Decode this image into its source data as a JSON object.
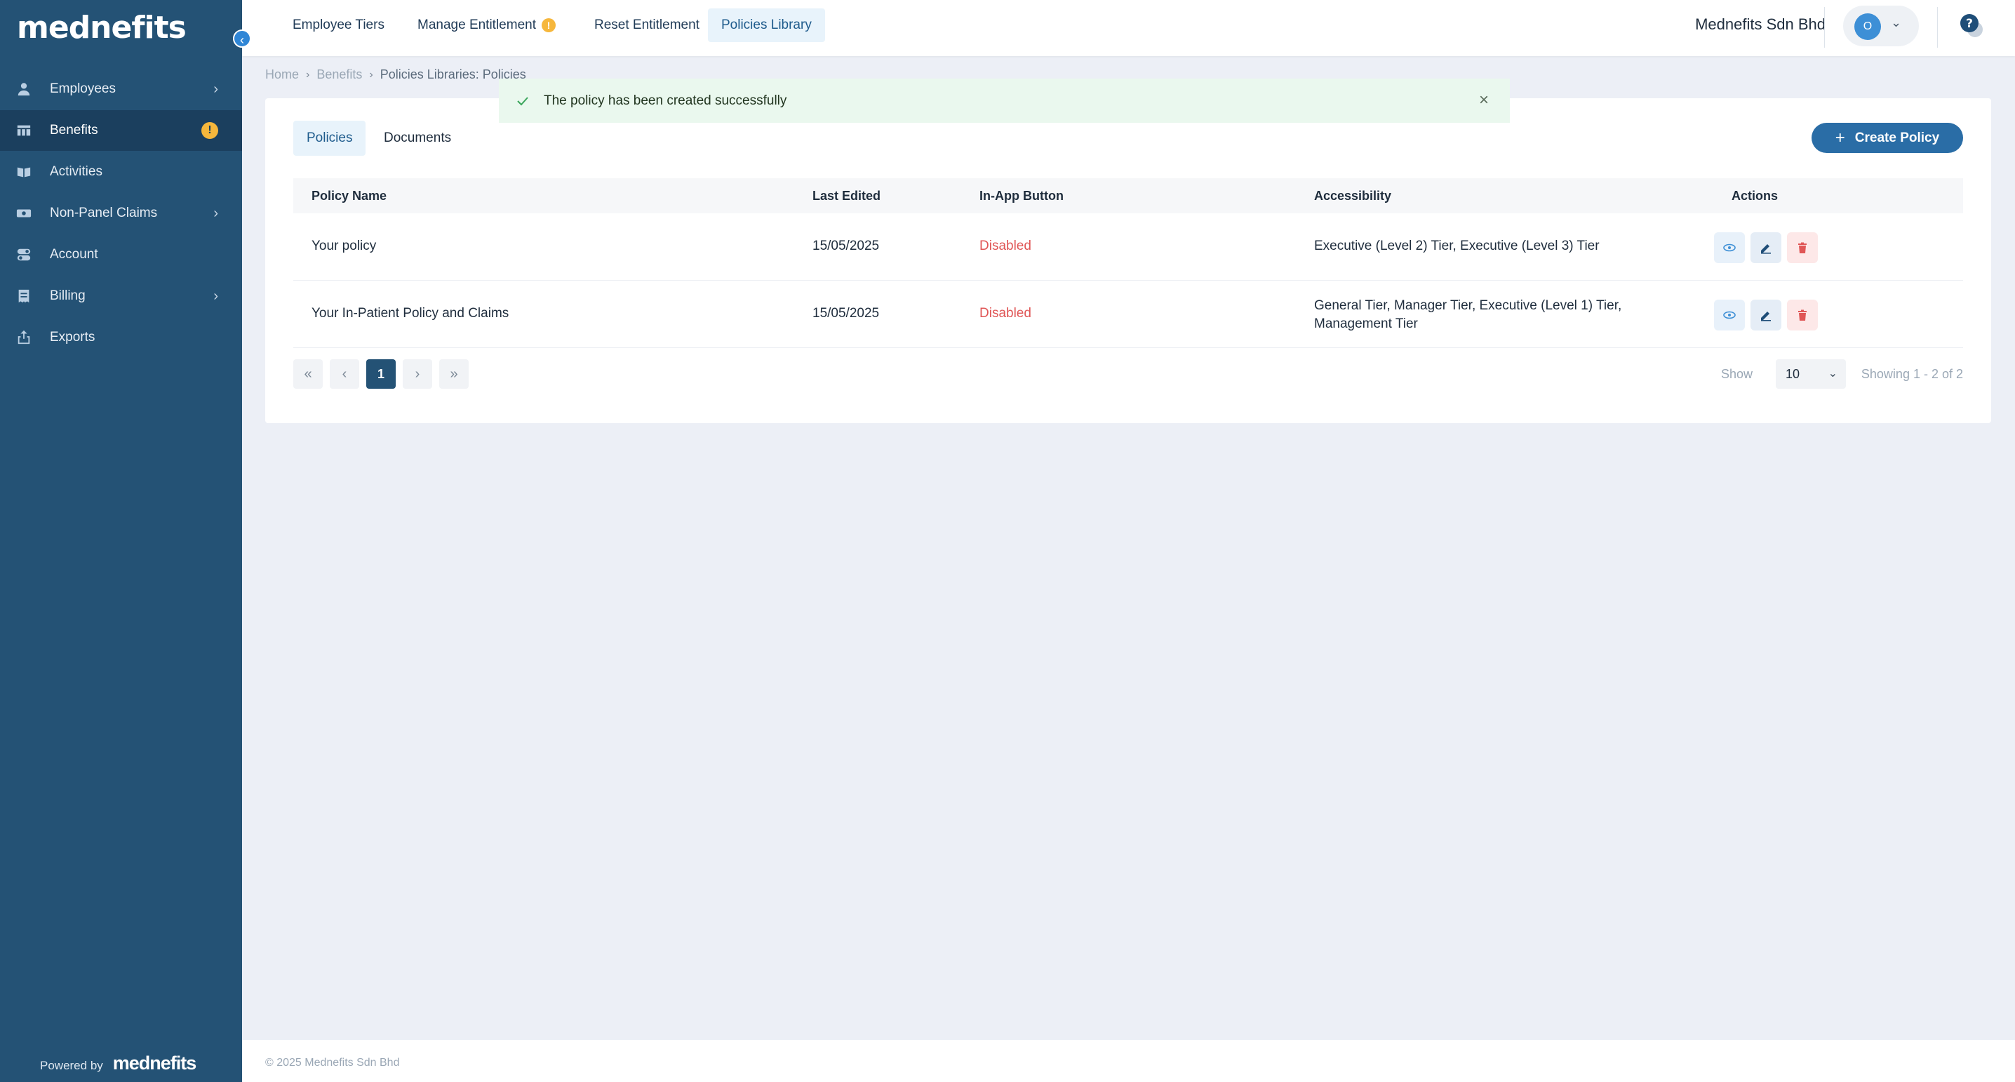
{
  "brand": {
    "logo_text": "mednefits",
    "powered_by": "Powered by"
  },
  "sidebar": {
    "items": [
      {
        "label": "Employees",
        "icon": "person-icon",
        "has_chevron": true
      },
      {
        "label": "Benefits",
        "icon": "table-icon",
        "badge": "!"
      },
      {
        "label": "Activities",
        "icon": "book-icon"
      },
      {
        "label": "Non-Panel Claims",
        "icon": "cash-icon",
        "has_chevron": true
      },
      {
        "label": "Account",
        "icon": "toggle-icon"
      },
      {
        "label": "Billing",
        "icon": "invoice-icon",
        "has_chevron": true
      },
      {
        "label": "Exports",
        "icon": "export-icon"
      }
    ]
  },
  "topnav": {
    "tabs": [
      {
        "label": "Employee Tiers"
      },
      {
        "label": "Manage Entitlement",
        "badge": "!"
      },
      {
        "label": "Reset Entitlement"
      },
      {
        "label": "Policies Library",
        "active": true
      }
    ],
    "company": "Mednefits Sdn Bhd",
    "avatar_initial": "O"
  },
  "breadcrumb": {
    "home": "Home",
    "benefits": "Benefits",
    "current": "Policies Libraries: Policies"
  },
  "toast": {
    "message": "The policy has been created successfully"
  },
  "card": {
    "tabs": [
      {
        "label": "Policies",
        "active": true
      },
      {
        "label": "Documents"
      }
    ],
    "create_label": "Create Policy"
  },
  "table": {
    "headers": {
      "name": "Policy Name",
      "edited": "Last Edited",
      "inapp": "In-App Button",
      "access": "Accessibility",
      "actions": "Actions"
    },
    "rows": [
      {
        "name": "Your policy",
        "edited": "15/05/2025",
        "inapp": "Disabled",
        "access": "Executive (Level 2) Tier, Executive (Level 3) Tier"
      },
      {
        "name": "Your In-Patient Policy and Claims",
        "edited": "15/05/2025",
        "inapp": "Disabled",
        "access": "General Tier, Manager Tier, Executive (Level 1) Tier, Management Tier"
      }
    ]
  },
  "pagination": {
    "first": "«",
    "prev": "‹",
    "page": "1",
    "next": "›",
    "last": "»",
    "show_label": "Show",
    "page_size": "10",
    "showing": "Showing 1 - 2 of 2"
  },
  "footer": {
    "copyright": "© 2025 Mednefits Sdn Bhd"
  },
  "colors": {
    "sidebar": "#245275",
    "accent": "#2a6da6",
    "danger": "#e05656",
    "warning": "#f6b73c"
  }
}
